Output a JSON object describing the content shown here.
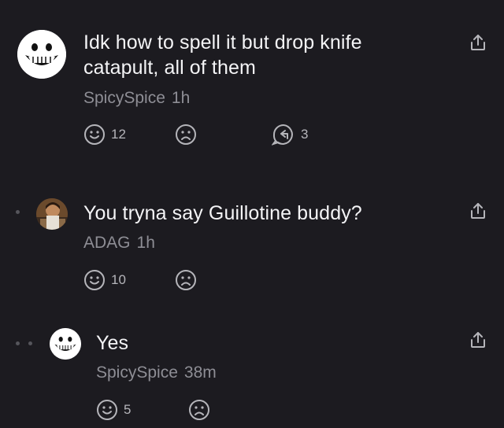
{
  "comments": [
    {
      "author": "SpicySpice",
      "time": "1h",
      "text_line1": "Idk how to spell it but drop knife",
      "text_line2": "catapult, all of them",
      "upvotes": "12",
      "replies": "3",
      "avatar": "smiling-face-avatar"
    },
    {
      "author": "ADAG",
      "time": "1h",
      "text": "You tryna say Guillotine buddy?",
      "upvotes": "10",
      "avatar": "photo-avatar"
    },
    {
      "author": "SpicySpice",
      "time": "38m",
      "text": "Yes",
      "upvotes": "5",
      "avatar": "smiling-face-avatar"
    }
  ],
  "icons": {
    "upvote": "smile-face-icon",
    "downvote": "frown-face-icon",
    "reply": "reply-arrow-icon",
    "share": "share-icon"
  },
  "colors": {
    "background": "#1c1b20",
    "text": "#f4f4f6",
    "muted": "#8e8e95",
    "icon": "#b5b5ba"
  }
}
